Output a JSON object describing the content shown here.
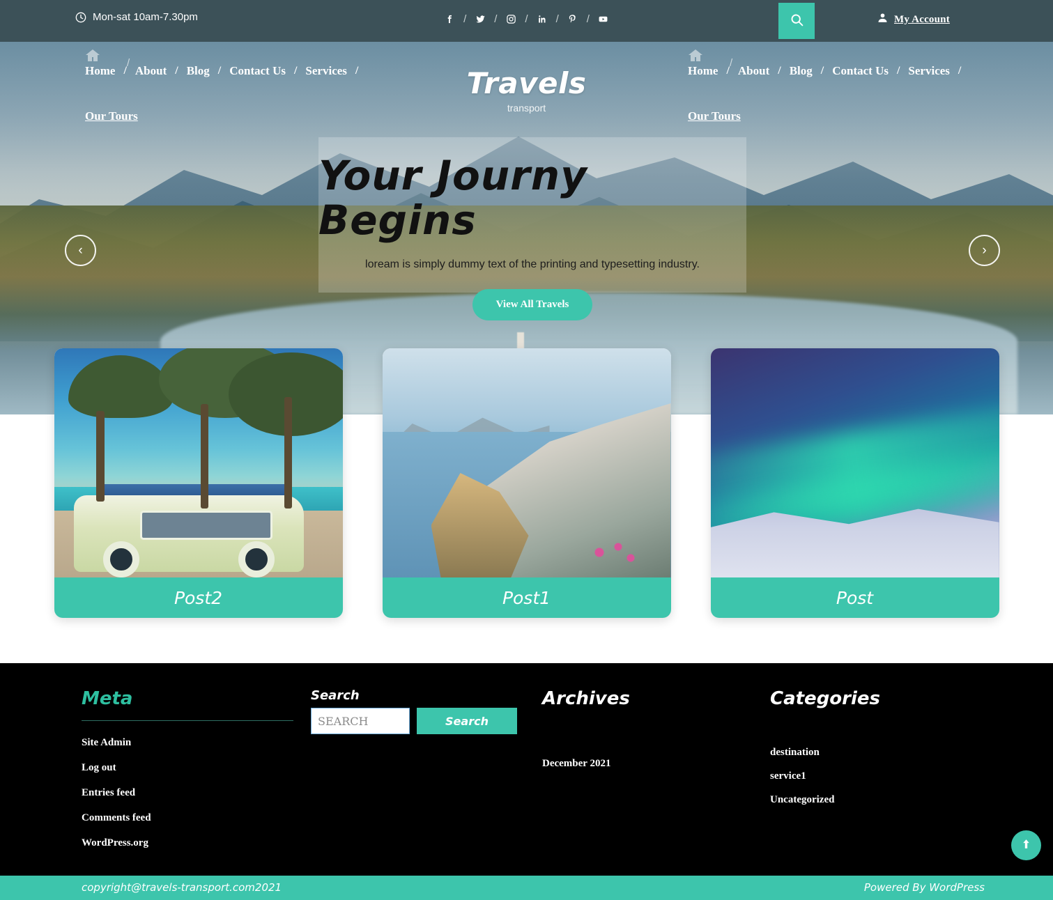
{
  "topbar": {
    "hours": "Mon-sat 10am-7.30pm",
    "socials": [
      {
        "name": "facebook-icon",
        "label": "f"
      },
      {
        "name": "twitter-icon",
        "label": "t"
      },
      {
        "name": "instagram-icon",
        "label": "ig"
      },
      {
        "name": "linkedin-icon",
        "label": "in"
      },
      {
        "name": "pinterest-icon",
        "label": "p"
      },
      {
        "name": "youtube-icon",
        "label": "yt"
      }
    ],
    "separator": "/",
    "search_icon": "search-icon",
    "account_label": "My Account",
    "account_icon": "user-icon"
  },
  "branding": {
    "name": "Travels",
    "tagline": "transport"
  },
  "nav": {
    "home_icon": "home-icon",
    "divider": "/",
    "items": [
      "Home",
      "About",
      "Blog",
      "Contact Us",
      "Services"
    ],
    "secondary_item": "Our Tours"
  },
  "hero": {
    "title": "Your Journy Begins",
    "subtitle": "loream is simply dummy text of the printing and typesetting industry.",
    "button": "View All Travels",
    "prev_icon": "chevron-left-icon",
    "next_icon": "chevron-right-icon",
    "prev_glyph": "‹",
    "next_glyph": "›"
  },
  "cards": [
    {
      "caption": "Post2",
      "image": "beach-palms-van-photo"
    },
    {
      "caption": "Post1",
      "image": "santorini-coast-photo"
    },
    {
      "caption": "Post",
      "image": "aurora-snow-photo"
    }
  ],
  "footer": {
    "meta": {
      "title": "Meta",
      "links": [
        "Site Admin",
        "Log out",
        "Entries feed",
        "Comments feed",
        "WordPress.org"
      ]
    },
    "search": {
      "title": "Search",
      "placeholder": "SEARCH",
      "value": "",
      "button": "Search"
    },
    "archives": {
      "title": "Archives",
      "items": [
        "December 2021"
      ]
    },
    "categories": {
      "title": "Categories",
      "items": [
        "destination",
        "service1",
        "Uncategorized"
      ]
    }
  },
  "bottombar": {
    "copyright": "copyright@travels-transport.com2021",
    "powered": "Powered By WordPress"
  },
  "scroll_top": {
    "icon": "arrow-up-icon"
  },
  "colors": {
    "accent_teal": "#3dc5ac",
    "topbar": "#3c5158",
    "footer": "#000000",
    "meta_heading": "#2ebfa0"
  }
}
